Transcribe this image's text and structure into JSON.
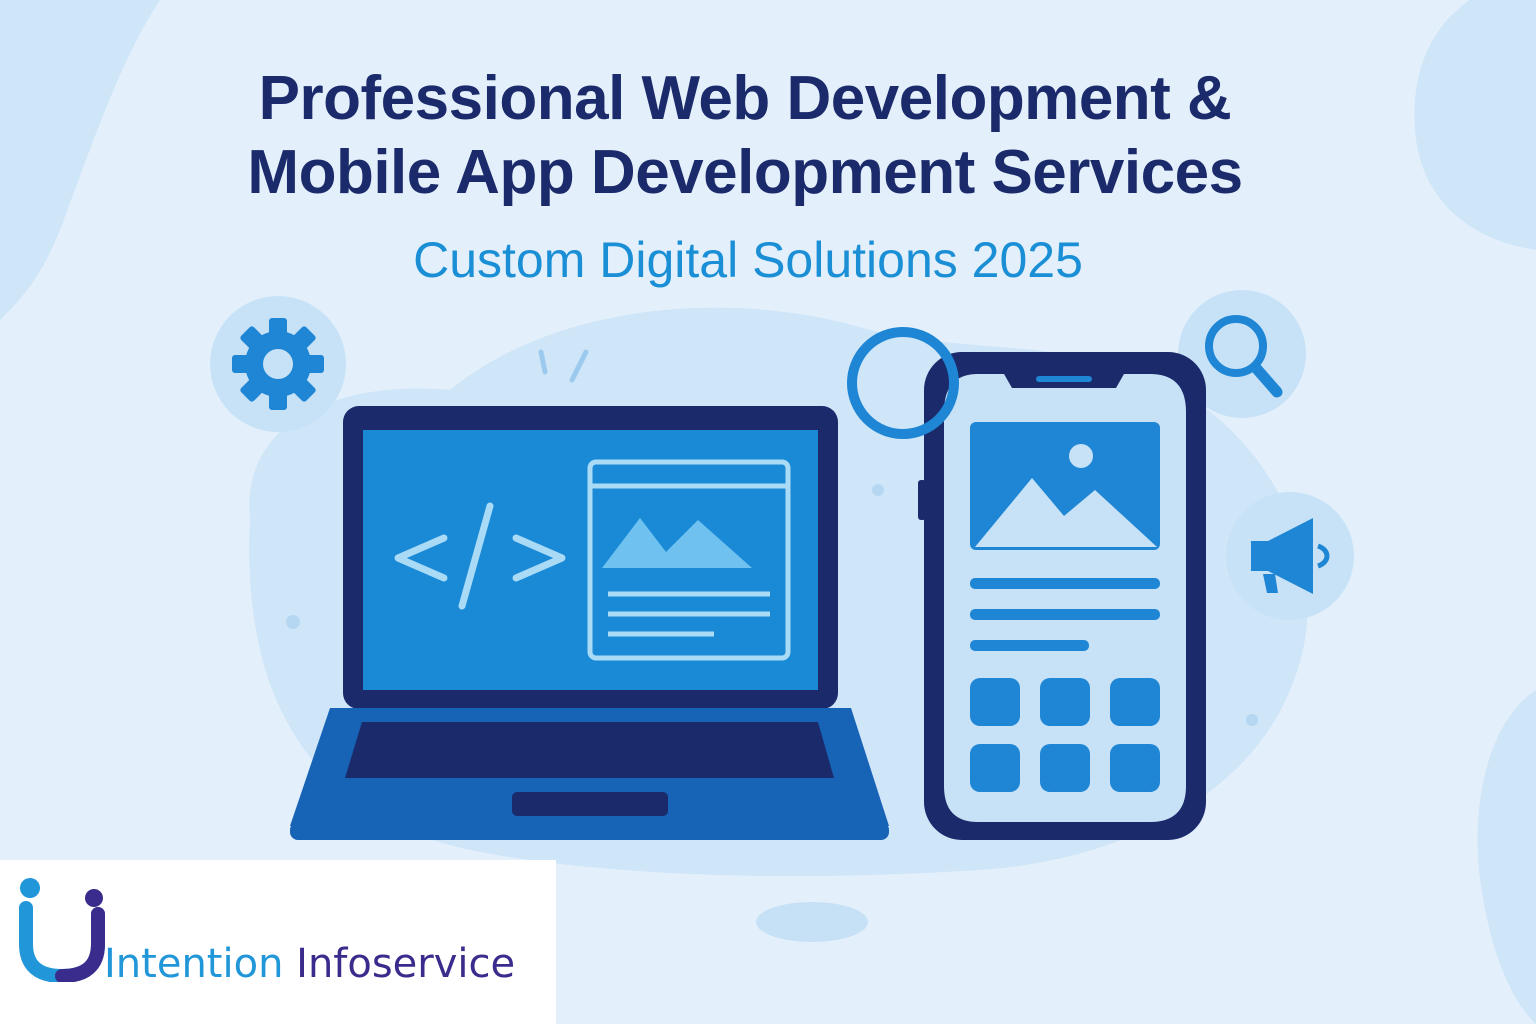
{
  "hero": {
    "title_line1": "Professional Web Development &",
    "title_line2": "Mobile App Development Services",
    "subtitle": "Custom Digital Solutions 2025"
  },
  "icons": [
    "gear-icon",
    "search-icon",
    "megaphone-icon",
    "code-icon",
    "image-icon"
  ],
  "brand": {
    "name_part1": "Intention",
    "name_part2": "Infoservice",
    "colors": {
      "navy": "#1b2a6b",
      "blue": "#1b8fd6",
      "purple": "#3a2c8c",
      "bg": "#e3f0fb"
    }
  }
}
